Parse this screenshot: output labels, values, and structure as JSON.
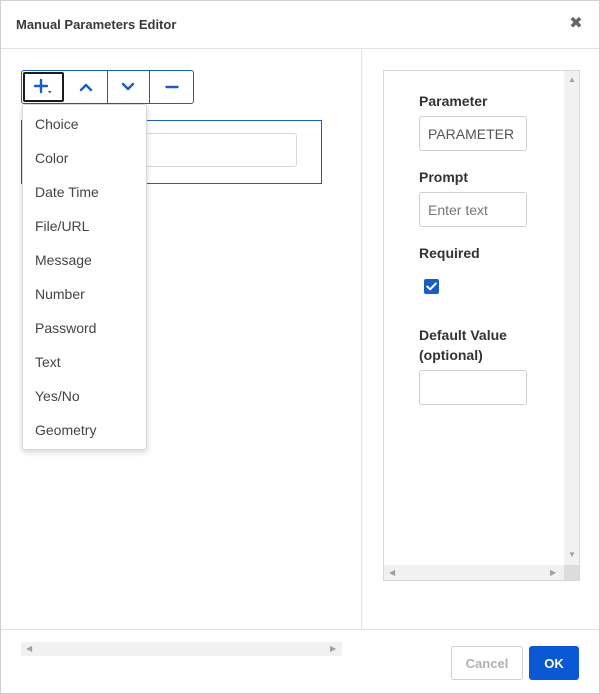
{
  "dialog": {
    "title": "Manual Parameters Editor",
    "close_icon": "close-icon"
  },
  "toolbar": {
    "buttons": [
      {
        "icon": "plus-dropdown-icon",
        "state": "active"
      },
      {
        "icon": "chevron-up-icon"
      },
      {
        "icon": "chevron-down-icon"
      },
      {
        "icon": "minus-icon"
      }
    ]
  },
  "type_menu": {
    "items": [
      "Choice",
      "Color",
      "Date Time",
      "File/URL",
      "Message",
      "Number",
      "Password",
      "Text",
      "Yes/No",
      "Geometry"
    ]
  },
  "properties": {
    "parameter_label": "Parameter",
    "parameter_value": "PARAMETER",
    "prompt_label": "Prompt",
    "prompt_placeholder": "Enter text",
    "required_label": "Required",
    "required_checked": true,
    "default_label_line1": "Default Value",
    "default_label_line2": "(optional)",
    "default_value": ""
  },
  "footer": {
    "cancel_label": "Cancel",
    "ok_label": "OK"
  },
  "colors": {
    "accent": "#1a5bc4",
    "primary_button": "#0b58d4"
  }
}
